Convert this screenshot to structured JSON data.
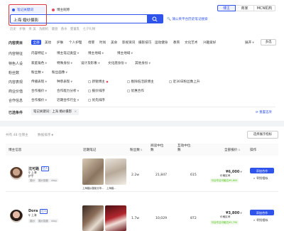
{
  "search": {
    "tabs": [
      "笔记关键词",
      "博主昵称"
    ],
    "query": "上海 婚纱摄影",
    "history_label": "历史",
    "history_items": [
      "护肤",
      "夹 美",
      "洗碗机",
      "键盘",
      "香水",
      "婴童乳",
      "七夕礼物"
    ],
    "compare_link": "蒲公英平台历史笔记搜索"
  },
  "top_tabs": [
    "博主",
    "商家",
    "MCN机构"
  ],
  "filters": {
    "content_category": {
      "label": "内容类目",
      "options": [
        "全部",
        "美妆",
        "护肤",
        "个人护理",
        "母婴",
        "时尚",
        "美食",
        "影视资讯",
        "摄影技巧",
        "运动健身",
        "教育",
        "文化艺术",
        "兴趣爱好"
      ],
      "expand_label": "展开",
      "multi_label": "多选"
    },
    "content_feature": {
      "label": "内容特征",
      "options": [
        "内容特征",
        "博主笔记类型",
        "博主地域",
        "博主地域"
      ]
    },
    "special_persona": {
      "label": "特色人设",
      "options": [
        "家庭角色",
        "特殊身份",
        "设计及形象",
        "文化底身份",
        "其他身份"
      ]
    },
    "follower_count": {
      "label": "粉丝数",
      "options": [
        "粉丝数",
        "粉丝画像"
      ]
    },
    "content_performance": {
      "label": "内容表现",
      "options": [
        "传播表现",
        "种草表现",
        "新锐博主",
        "剔除低活跃博主",
        "近30日粉丝数上升"
      ]
    },
    "commercial_value": {
      "label": "商业价值",
      "options": [
        "合作报价",
        "合作能力分析",
        "报价排序",
        "优惠合作"
      ]
    },
    "collab_info": {
      "label": "合作信息",
      "options": [
        "合作报价",
        "近期合作行业",
        "优先排序"
      ]
    },
    "selected": {
      "label": "已选条件",
      "chip": "笔记关键词：上海 婚纱摄影",
      "reset_label": "重置选项"
    }
  },
  "results": {
    "count_text": "共有 48 位博主",
    "sort_label": "数据排序",
    "export_label": "选择展示指标"
  },
  "table": {
    "headers": [
      "博主信息",
      "近期笔记",
      "粉丝数",
      "阅读中位数",
      "互动中位数",
      "全部报价",
      "操作"
    ],
    "rows": [
      {
        "name": "沈可路",
        "badge": "达人",
        "location": "上海",
        "sub": "护手",
        "tags": [
          "婚纱",
          "婚纱摄影",
          "vlog"
        ],
        "notes": [
          "上海婚纱摄影分享...",
          "上海婚..."
        ],
        "followers": "2.2w",
        "reads": "21,847",
        "interactions": "615",
        "price": "¥6,000",
        "price_note": "价格区间",
        "rating": "可合作且可触达¥5,800",
        "actions": [
          "添加合作",
          "寻找相似"
        ]
      },
      {
        "name": "Dora",
        "badge": "达人",
        "location": "上海",
        "sub": "",
        "tags": [
          "婚纱",
          "婚纱摄影",
          "vlog"
        ],
        "notes": [
          "上海婚纱摄影分享...",
          "上海婚..."
        ],
        "followers": "1.7w",
        "reads": "10,029",
        "interactions": "872",
        "price": "¥3,800",
        "price_note": "价格区间",
        "rating": "可合作且可触达¥3,790",
        "actions": [
          "添加合作",
          "寻找相似"
        ]
      }
    ]
  },
  "colors": {
    "accent": "#2f54eb",
    "highlight_box": "#d9363e",
    "green": "#52c41a"
  }
}
